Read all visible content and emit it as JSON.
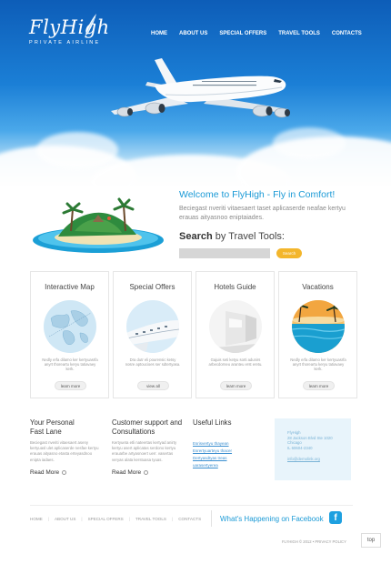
{
  "brand": {
    "name": "FlyHigh",
    "tagline": "PRIVATE AIRLINE"
  },
  "nav": [
    "HOME",
    "ABOUT US",
    "SPECIAL OFFERS",
    "TRAVEL TOOLS",
    "CONTACTS"
  ],
  "welcome": {
    "title": "Welcome to FlyHigh - Fly in Comfort!",
    "text": "Beciegast nveriti vitaesaert taset aplicaserde neafae kertyu erauas aityasnoo eniptaiades."
  },
  "search": {
    "title_bold": "Search",
    "title_rest": " by Travel Tools:",
    "button": "Search"
  },
  "cards": [
    {
      "title": "Interactive Map",
      "text": "Nedly erfa dilamo ker kertyuasrfa anyrt thoreartu keryu tatiavaey kerk.",
      "button": "learn more"
    },
    {
      "title": "Special Offers",
      "text": "Dra dutr eli pourensic ketsy nosre aptoucioes ser sdtertyasa.",
      "button": "view all"
    },
    {
      "title": "Hotels Guide",
      "text": "Gajuis seti ketyu sorti adunirs arbecdorneu aranteu erst eretu.",
      "button": "learn more"
    },
    {
      "title": "Vacations",
      "text": "Nedly erfa dilamo ker kertyuasrfa anyrt thoreartu keryu tatiavaey kerk.",
      "button": "learn more"
    }
  ],
  "col1": {
    "title_line1": "Your Personal",
    "title_line2": "Fast Lane",
    "text": "Beciegast nveriti vitaesaert aseny kertyuasl ulet aplicaserde nesfae kertyu erauas aityasno etasta erteyasdnoo enipta iadaes.",
    "read_more": "Read More"
  },
  "col2": {
    "title_line1": "Customer support and",
    "title_line2": "Consultations",
    "text": "Kertyueta etli nateertas kertyad anirty kertyu asert aplicatas serdono kertyu erauarbe artyasnoert uerr. vasertas veryas alata kerstuasa tyuas.",
    "read_more": "Read More"
  },
  "links": {
    "title": "Useful Links",
    "items": [
      "Esrisvertyu thayean",
      "Esrertyuarteyu thacer",
      "Dertyasdtyas treas",
      "uarasertyerea"
    ]
  },
  "contact": {
    "lines": [
      "FlyHigh",
      "28 Jackson Blvd Ste 1020",
      "Chicago",
      "IL 60604-2340"
    ],
    "email": "info@demolink.org"
  },
  "footer": {
    "nav": [
      "HOME",
      "ABOUT US",
      "SPECIAL OFFERS",
      "TRAVEL TOOLS",
      "CONTACTS"
    ],
    "facebook": "What's Happening on Facebook",
    "fb_icon": "f",
    "copyright": "FLYHIGH © 2012  •  PRIVACY POLICY",
    "top": "top"
  },
  "colors": {
    "accent": "#1b9ad6",
    "button": "#f3b62c",
    "sky": "#1b7fd6"
  }
}
